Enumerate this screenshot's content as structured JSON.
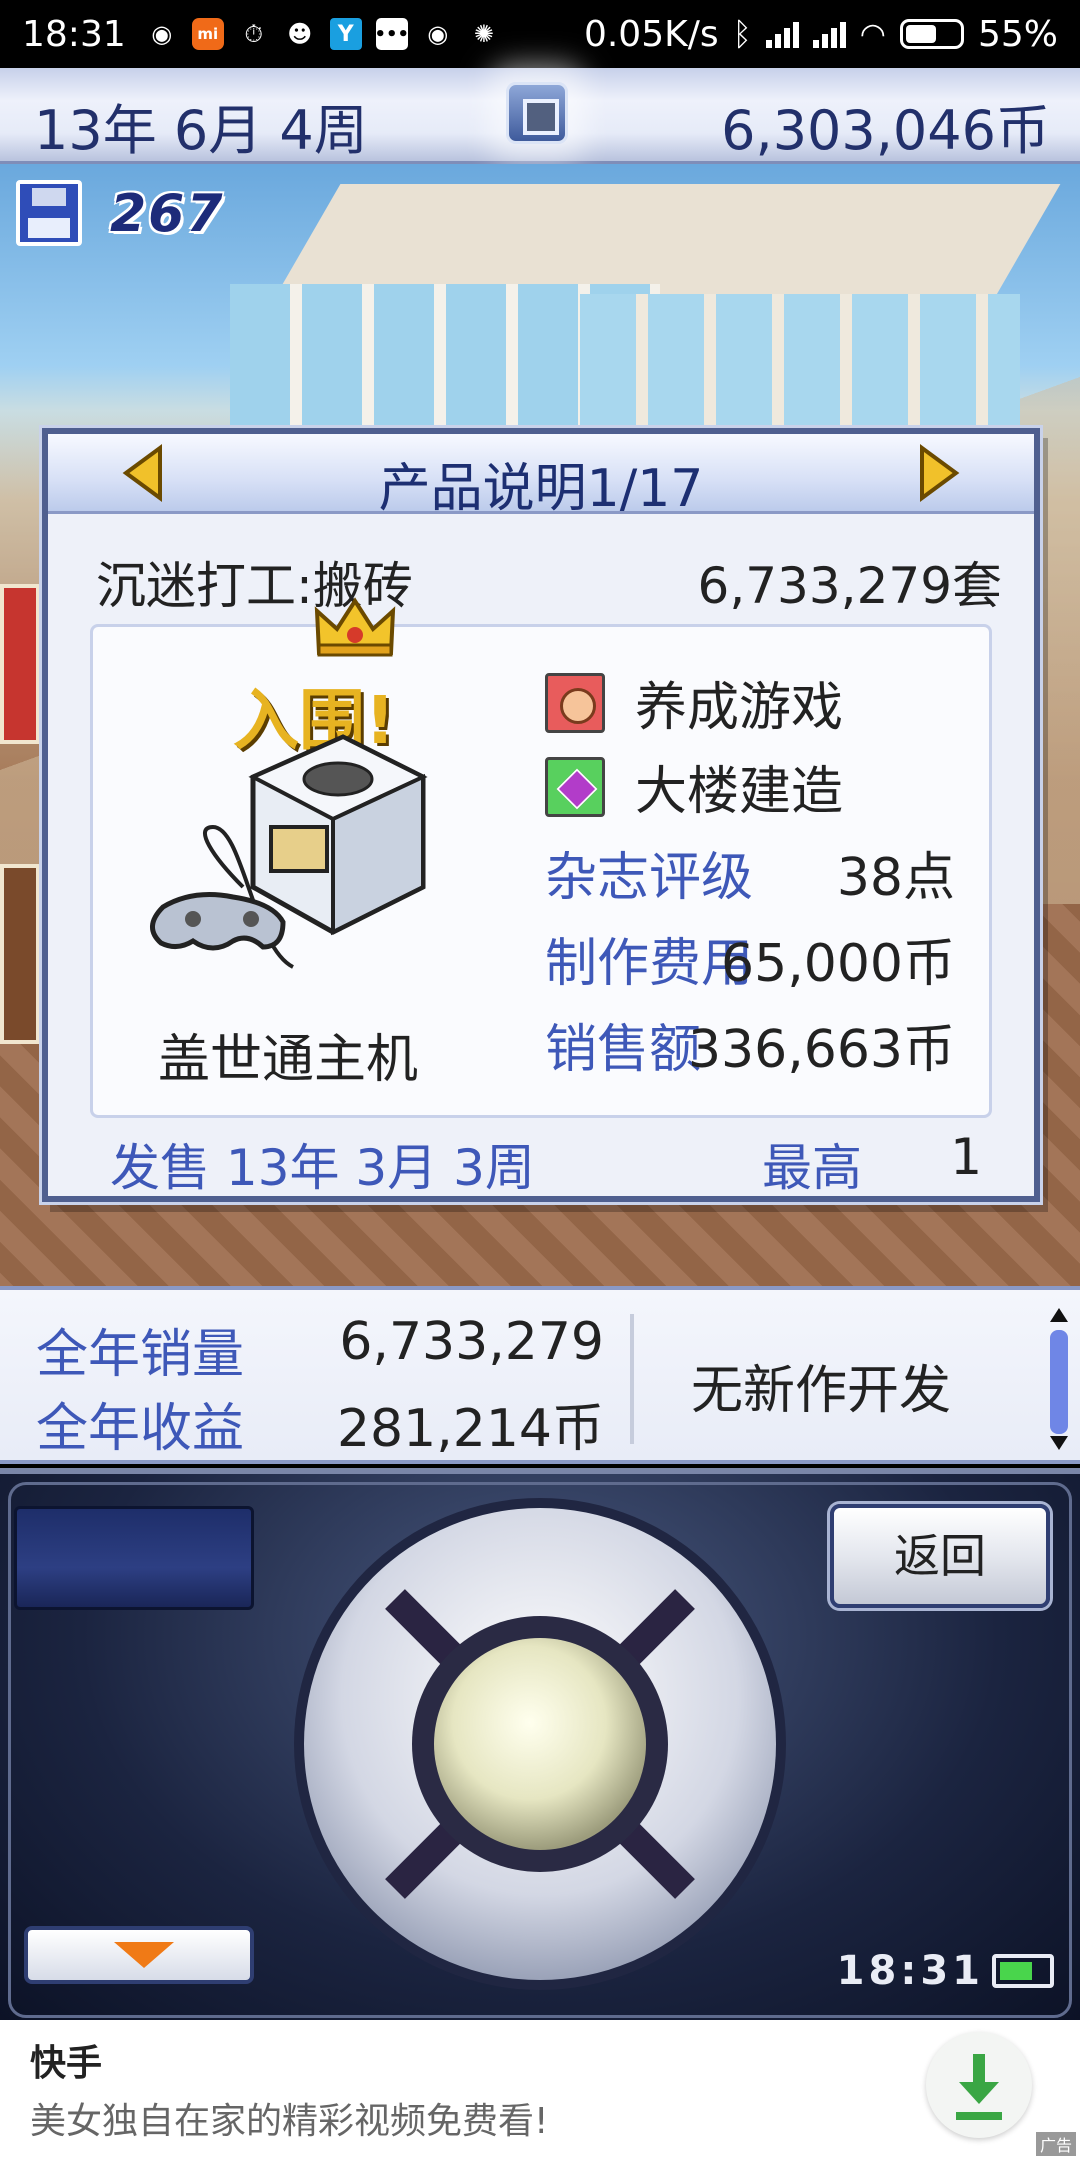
{
  "status_bar": {
    "time": "18:31",
    "net_speed": "0.05K/s",
    "battery": "55%",
    "icons": [
      "location-icon",
      "mi-icon",
      "stopwatch-icon",
      "pig-icon",
      "y-app-icon",
      "message-icon",
      "location-icon",
      "compass-icon",
      "bluetooth-icon",
      "signal-icon",
      "wifi-icon",
      "battery-icon"
    ]
  },
  "header": {
    "date": "13年 6月 4周",
    "money": "6,303,046币"
  },
  "scene": {
    "save_count": "267"
  },
  "dialog": {
    "title": "产品说明1/17",
    "product_name": "沉迷打工:搬砖",
    "units_sold": "6,733,279套",
    "award": "入围!",
    "console_name": "盖世通主机",
    "genre": "养成游戏",
    "theme": "大楼建造",
    "stats": [
      {
        "label": "杂志评级",
        "value": "38点"
      },
      {
        "label": "制作费用",
        "value": "65,000币"
      },
      {
        "label": "销售额",
        "value": "336,663币"
      }
    ],
    "release": "发售 13年 3月 3周",
    "rank_label": "最高",
    "rank_value": "1"
  },
  "summary": {
    "annual_sales_label": "全年销量",
    "annual_sales_value": "6,733,279",
    "annual_revenue_label": "全年收益",
    "annual_revenue_value": "281,214币",
    "dev_status": "无新作开发"
  },
  "controller": {
    "back_label": "返回",
    "clock": "18:31"
  },
  "ad": {
    "app_name": "快手",
    "description": "美女独自在家的精彩视频免费看!",
    "tag": "广告"
  }
}
